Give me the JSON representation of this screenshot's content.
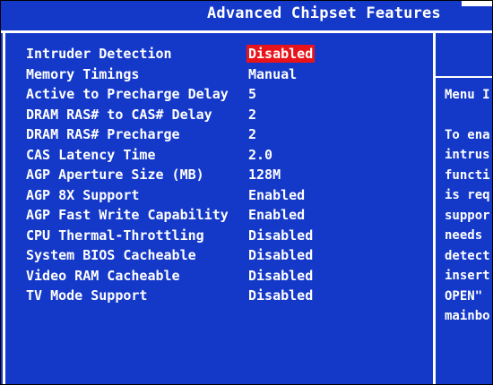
{
  "header": {
    "title": "Advanced Chipset Features"
  },
  "settings": [
    {
      "label": "Intruder Detection",
      "value": "Disabled",
      "selected": true
    },
    {
      "label": "Memory Timings",
      "value": "Manual"
    },
    {
      "label": "Active to Precharge Delay",
      "value": "5"
    },
    {
      "label": "DRAM RAS# to CAS# Delay",
      "value": "2"
    },
    {
      "label": "DRAM RAS# Precharge",
      "value": "2"
    },
    {
      "label": "CAS Latency Time",
      "value": "2.0"
    },
    {
      "label": "AGP Aperture Size (MB)",
      "value": "128M"
    },
    {
      "label": "AGP 8X Support",
      "value": "Enabled"
    },
    {
      "label": "AGP Fast Write Capability",
      "value": "Enabled"
    },
    {
      "label": "CPU Thermal-Throttling",
      "value": "Disabled"
    },
    {
      "label": "System BIOS Cacheable",
      "value": "Disabled"
    },
    {
      "label": "Video RAM Cacheable",
      "value": "Disabled"
    },
    {
      "label": "TV Mode Support",
      "value": "Disabled"
    }
  ],
  "help": {
    "title": "Menu I",
    "lines": [
      "To ena",
      "intrus",
      "functi",
      "is req",
      "suppor",
      "needs",
      "detect",
      "insert",
      "OPEN\"",
      "mainbo"
    ]
  },
  "colors": {
    "background": "#1438c8",
    "text": "#ffffff",
    "highlight": "#e8141a"
  }
}
